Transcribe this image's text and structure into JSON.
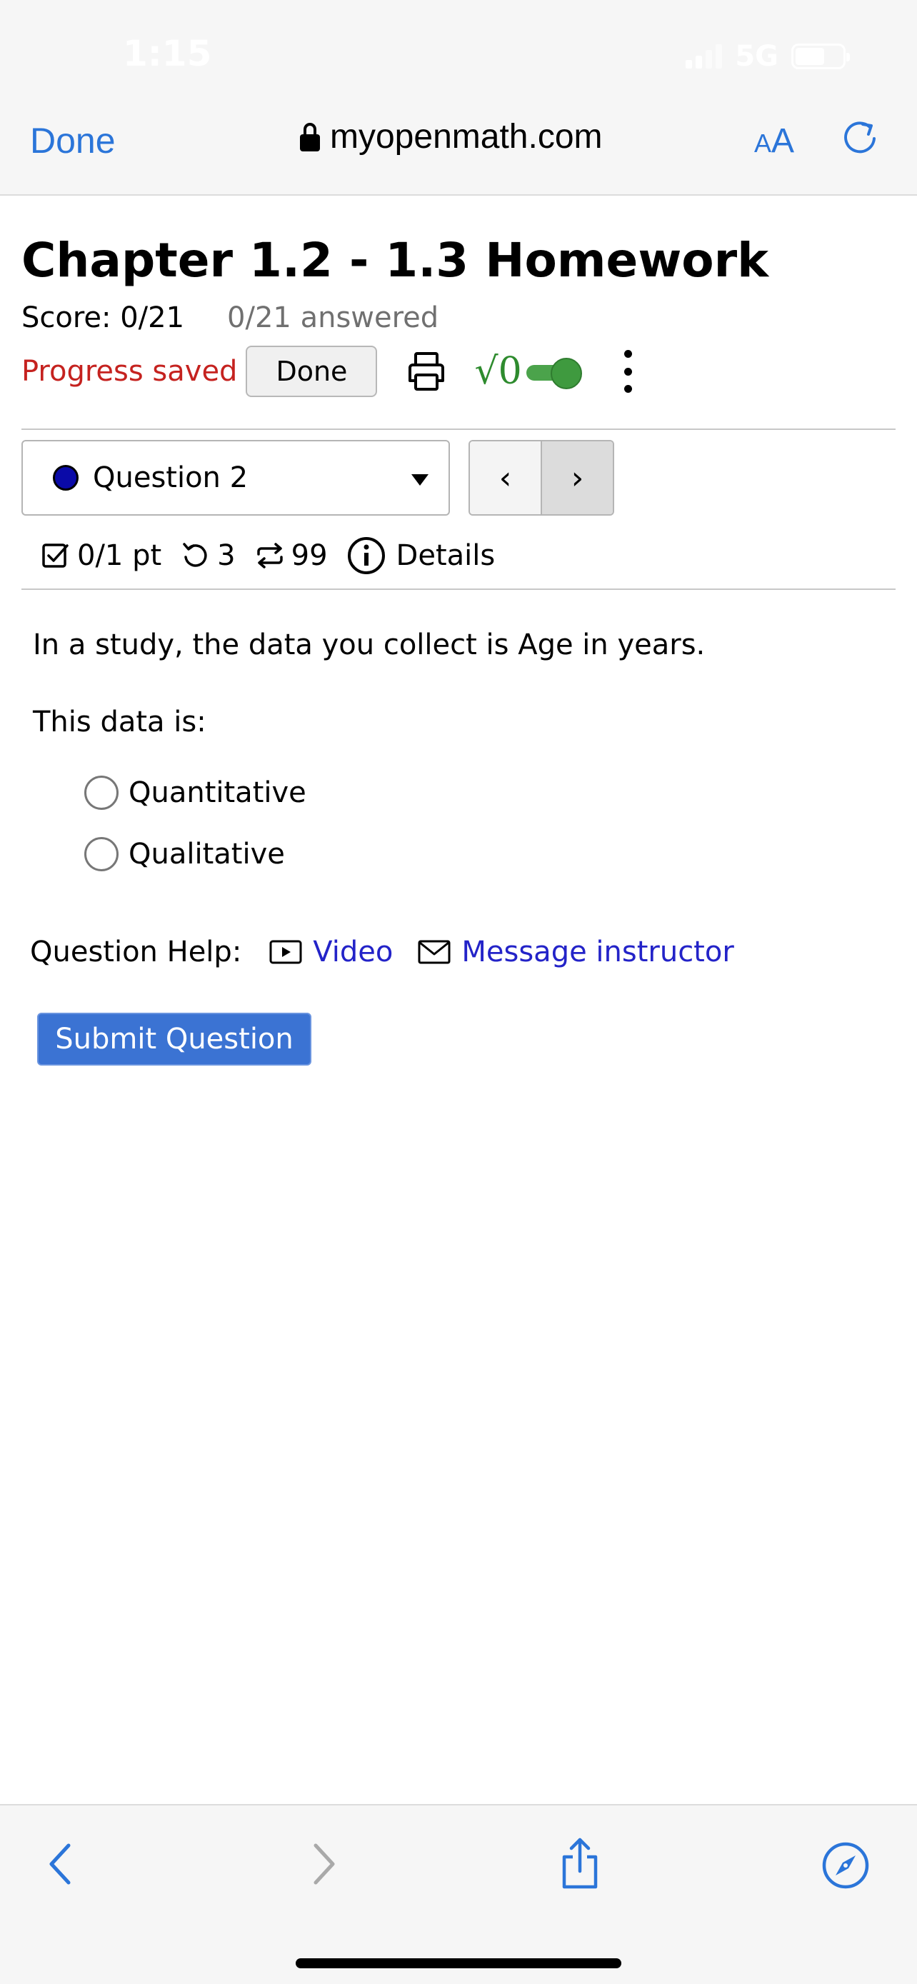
{
  "status_bar": {
    "time": "1:15",
    "network": "5G"
  },
  "browser": {
    "done_label": "Done",
    "url": "myopenmath.com",
    "text_size_small": "A",
    "text_size_big": "A"
  },
  "assessment": {
    "title": "Chapter 1.2 - 1.3 Homework",
    "score": "Score: 0/21",
    "answered": "0/21 answered",
    "progress_saved": "Progress saved",
    "done_button": "Done",
    "math_toggle_symbol": "√0"
  },
  "question_nav": {
    "selected_question": "Question 2",
    "prev_label": "‹",
    "next_label": "›"
  },
  "question_meta": {
    "points": "0/1 pt",
    "retries": "3",
    "regens": "99",
    "details_label": "Details"
  },
  "question": {
    "text": "In a study, the data you collect is Age in years.",
    "prompt": "This data is:",
    "options": [
      "Quantitative",
      "Qualitative"
    ]
  },
  "help": {
    "label": "Question Help:",
    "video_label": "Video",
    "message_label": "Message instructor"
  },
  "submit_label": "Submit Question",
  "colors": {
    "safari_blue": "#2b75d9",
    "progress_red": "#c5221f",
    "toggle_green": "#3f9a3f",
    "submit_blue": "#3b73d3",
    "link_blue": "#2323c8"
  }
}
